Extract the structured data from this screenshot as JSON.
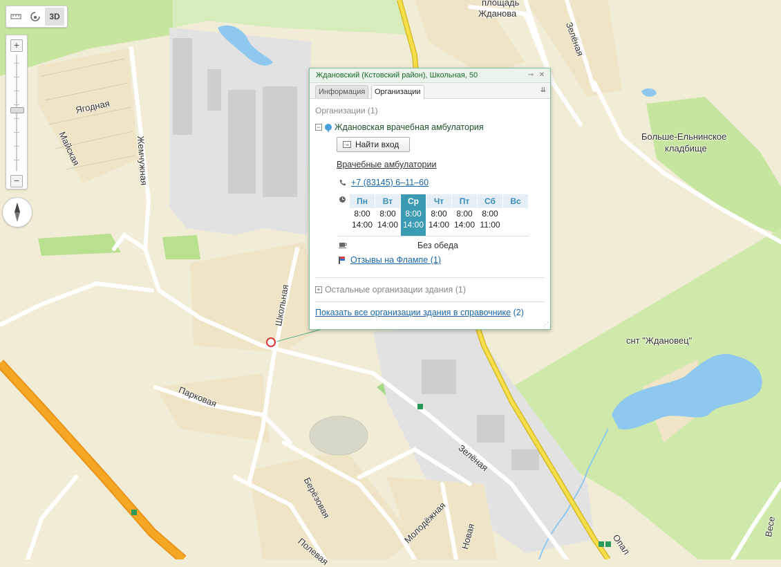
{
  "map": {
    "labels": {
      "square": "площадь",
      "square2": "Жданова",
      "zelenaya_top": "Зелёная",
      "yagodnaya": "Ягодная",
      "maiskaya": "Майская",
      "zhemchuzhnaya": "Жемчужная",
      "cemetery1": "Больше-Ельнинское",
      "cemetery2": "кладбище",
      "snt": "снт \"Ждановец\"",
      "shkolnaya": "Школьная",
      "parkovaya": "Парковая",
      "zelenaya_bottom": "Зелёная",
      "berezovaya": "Берёзовая",
      "molodezhnaya": "Молодёжная",
      "novaya": "Новая",
      "polevaya": "Полевая",
      "opal": "Опал",
      "ves": "Весе"
    },
    "colors": {
      "land": "#f1ecd6",
      "green": "#c6e6a0",
      "water": "#8fc8ee",
      "road_major": "#f5a623",
      "road_yellow": "#f6e04a",
      "industrial": "#dcdcdc",
      "residential": "#efe5c6"
    }
  },
  "toolbar": {
    "ruler_icon": "ruler-icon",
    "rotate_icon": "rotate-icon",
    "mode_3d": "3D"
  },
  "zoom": {
    "plus": "+",
    "minus": "−",
    "level_fraction": 0.62
  },
  "popup": {
    "title": "Ждановский (Кстовский район), Школьная, 50",
    "tabs": [
      "Информация",
      "Организации"
    ],
    "active_tab": 1,
    "orgs_heading": "Организации (1)",
    "org_name": "Ждановская врачебная амбулатория",
    "find_entrance": "Найти вход",
    "rubric": "Врачебные амбулатории",
    "phone": "+7 (83145) 6–11–60",
    "schedule": [
      {
        "day": "Пн",
        "open": "8:00",
        "close": "14:00"
      },
      {
        "day": "Вт",
        "open": "8:00",
        "close": "14:00"
      },
      {
        "day": "Ср",
        "open": "8:00",
        "close": "14:00"
      },
      {
        "day": "Чт",
        "open": "8:00",
        "close": "14:00"
      },
      {
        "day": "Пт",
        "open": "8:00",
        "close": "14:00"
      },
      {
        "day": "Сб",
        "open": "8:00",
        "close": "11:00"
      },
      {
        "day": "Вс",
        "open": "",
        "close": ""
      }
    ],
    "today_index": 2,
    "lunch": "Без обеда",
    "reviews": "Отзывы на Флампе (1)",
    "other_orgs": "Остальные организации здания (1)",
    "show_all_link": "Показать все организации здания в справочнике",
    "show_all_count": "(2)"
  }
}
